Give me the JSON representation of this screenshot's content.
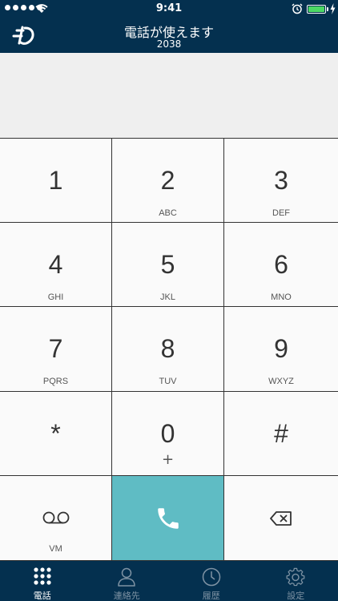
{
  "status_bar": {
    "time": "9:41",
    "battery_color": "#4cd964"
  },
  "header": {
    "title": "電話が使えます",
    "subtitle": "2038",
    "logo_icon": "app-logo-icon",
    "background": "#04304f"
  },
  "display": {
    "number": ""
  },
  "keypad": {
    "keys": [
      {
        "digit": "1",
        "letters": ""
      },
      {
        "digit": "2",
        "letters": "ABC"
      },
      {
        "digit": "3",
        "letters": "DEF"
      },
      {
        "digit": "4",
        "letters": "GHI"
      },
      {
        "digit": "5",
        "letters": "JKL"
      },
      {
        "digit": "6",
        "letters": "MNO"
      },
      {
        "digit": "7",
        "letters": "PQRS"
      },
      {
        "digit": "8",
        "letters": "TUV"
      },
      {
        "digit": "9",
        "letters": "WXYZ"
      },
      {
        "digit": "*",
        "letters": ""
      },
      {
        "digit": "0",
        "letters": "+"
      },
      {
        "digit": "#",
        "letters": ""
      }
    ],
    "voicemail_label": "VM",
    "call_color": "#5fbcc4"
  },
  "tabs": [
    {
      "label": "電話",
      "icon": "keypad-icon",
      "active": true
    },
    {
      "label": "連絡先",
      "icon": "contacts-icon",
      "active": false
    },
    {
      "label": "履歴",
      "icon": "clock-icon",
      "active": false
    },
    {
      "label": "設定",
      "icon": "gear-icon",
      "active": false
    }
  ]
}
